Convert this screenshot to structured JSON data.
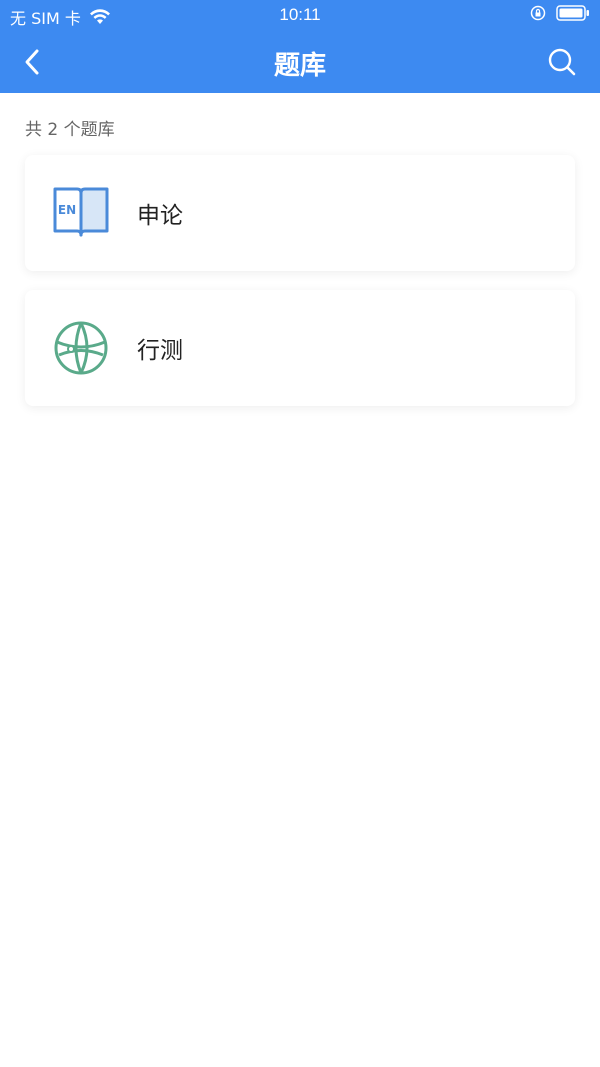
{
  "status_bar": {
    "carrier": "无 SIM 卡",
    "time": "10:11"
  },
  "nav": {
    "title": "题库"
  },
  "count_text": "共 2 个题库",
  "banks": [
    {
      "label": "申论",
      "icon": "book-en-icon",
      "icon_color": "#4a8ad9"
    },
    {
      "label": "行测",
      "icon": "globe-icon",
      "icon_color": "#5aaa8a"
    }
  ],
  "colors": {
    "header": "#3d8af1",
    "background": "#ffffff"
  }
}
